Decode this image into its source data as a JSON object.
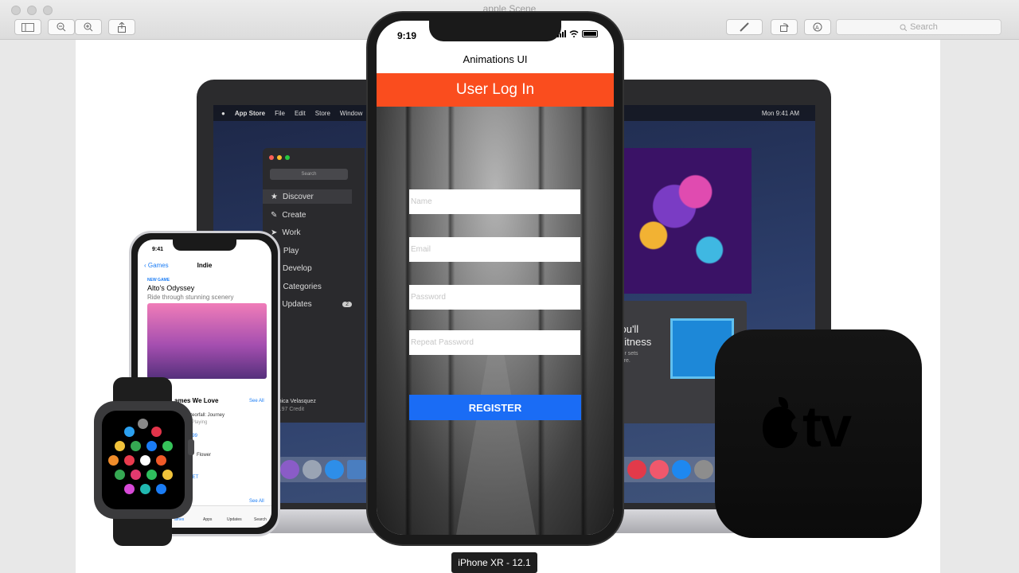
{
  "window": {
    "title": "apple Scene",
    "search_placeholder": "Search"
  },
  "mac": {
    "menubar": {
      "app_name": "App Store",
      "items": [
        "File",
        "Edit",
        "Store",
        "Window",
        "He"
      ],
      "clock": "Mon 9:41 AM"
    },
    "app_store": {
      "search_placeholder": "Search",
      "sidebar": [
        {
          "label": "Discover",
          "icon": "star-icon"
        },
        {
          "label": "Create",
          "icon": "hammer-icon"
        },
        {
          "label": "Work",
          "icon": "paper-plane-icon"
        },
        {
          "label": "Play",
          "icon": "rocket-icon"
        },
        {
          "label": "Develop",
          "icon": "hammer-icon"
        },
        {
          "label": "Categories",
          "icon": "grid-icon"
        },
        {
          "label": "Updates",
          "icon": "download-icon",
          "badge": "2"
        }
      ],
      "user_name": "Monica Velasquez",
      "user_credit": "$29.97 Credit"
    },
    "game_card": {
      "title": "You'll\nWitness",
      "subtitle": "zzler sets\ngenre."
    }
  },
  "iphone_left": {
    "time": "9:41",
    "back_label": "Games",
    "nav_title": "Indie",
    "badge": "NEW GAME",
    "game_title": "Alto's Odyssey",
    "game_subtitle": "Ride through stunning scenery",
    "section_title": "ames We Love",
    "see_all": "See All",
    "row1_title": "Meteorfall: Journey",
    "row1_sub": "ole Playing",
    "row1_price": "$2.99",
    "row2_title": "Flower",
    "row2_action": "GET",
    "see_all_2": "See All",
    "tabs": [
      "ames",
      "Apps",
      "Updates",
      "Search"
    ]
  },
  "apple_tv": {
    "logo_text": "tv"
  },
  "simulator": {
    "time": "9:19",
    "nav_title": "Animations UI",
    "header": "User Log In",
    "fields": {
      "name_placeholder": "Name",
      "email_placeholder": "Email",
      "password_placeholder": "Password",
      "repeat_placeholder": "Repeat Password"
    },
    "register_label": "REGISTER",
    "device_label": "iPhone XR - 12.1"
  },
  "colors": {
    "header_orange": "#fa4d1e",
    "register_blue": "#1a6cf5"
  }
}
